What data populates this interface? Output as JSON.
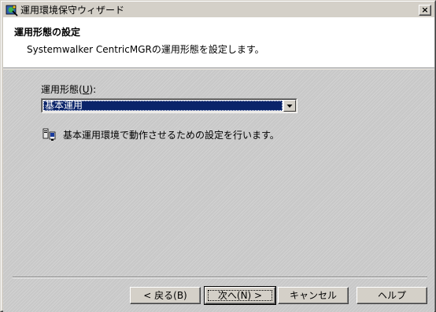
{
  "window": {
    "title": "運用環境保守ウィザード",
    "close_label": "×"
  },
  "header": {
    "title": "運用形態の設定",
    "subtitle": "Systemwalker CentricMGRの運用形態を設定します。"
  },
  "form": {
    "mode_label_prefix": "運用形態(",
    "mode_label_accel": "U",
    "mode_label_suffix": "):",
    "mode_selected": "基本運用",
    "info_text": "基本運用環境で動作させるための設定を行います。"
  },
  "buttons": {
    "back": "< 戻る(B)",
    "next": "次へ(N) >",
    "cancel": "キャンセル",
    "help": "ヘルプ"
  },
  "colors": {
    "selection": "#0a246a",
    "face": "#d4d0c8"
  }
}
